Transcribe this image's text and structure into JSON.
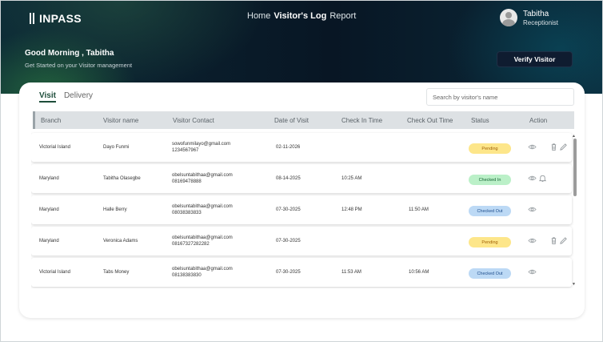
{
  "brand": {
    "logo_text": "INPASS"
  },
  "nav": {
    "items": [
      "Home",
      "Visitor's Log",
      "Report"
    ],
    "active": "Visitor's Log"
  },
  "user": {
    "name": "Tabitha",
    "role": "Receptionist"
  },
  "hero": {
    "greeting": "Good Morning , Tabitha",
    "subtitle": "Get Started on your Visitor management",
    "verify_button": "Verify Visitor"
  },
  "tabs": {
    "visit": "Visit",
    "delivery": "Delivery",
    "active": "Visit"
  },
  "search": {
    "placeholder": "Search by visitor's name",
    "value": ""
  },
  "table": {
    "headers": {
      "branch": "Branch",
      "visitor_name": "Visitor name",
      "visitor_contact": "Visitor Contact",
      "date_of_visit": "Date of Visit",
      "check_in": "Check In Time",
      "check_out": "Check Out Time",
      "status": "Status",
      "action": "Action"
    },
    "rows": [
      {
        "branch": "Victorial Island",
        "name": "Dayo Funmi",
        "email": "sowofunmilayo@gmail.com",
        "phone": "1234567967",
        "date": "02-11-2026",
        "check_in": "",
        "check_out": "",
        "status": "Pending",
        "actions": [
          "eye-icon",
          "trash-icon",
          "pencil-icon"
        ]
      },
      {
        "branch": "Maryland",
        "name": "Tabitha Olasegbe",
        "email": "obelsuntabithaa@gmail.com",
        "phone": "08169478888",
        "date": "08-14-2025",
        "check_in": "10:25 AM",
        "check_out": "",
        "status": "Checked In",
        "actions": [
          "eye-icon",
          "bell-icon"
        ]
      },
      {
        "branch": "Maryland",
        "name": "Halle Berry",
        "email": "obelsuntabithaa@gmail.com",
        "phone": "08038383833",
        "date": "07-30-2025",
        "check_in": "12:48 PM",
        "check_out": "11:50 AM",
        "status": "Checked Out",
        "actions": [
          "eye-icon"
        ]
      },
      {
        "branch": "Maryland",
        "name": "Veronica Adams",
        "email": "obelsuntabithaa@gmail.com",
        "phone": "08167327282282",
        "date": "07-30-2025",
        "check_in": "",
        "check_out": "",
        "status": "Pending",
        "actions": [
          "eye-icon",
          "trash-icon",
          "pencil-icon"
        ]
      },
      {
        "branch": "Victorial Island",
        "name": "Tabs Money",
        "email": "obelsuntabithaa@gmail.com",
        "phone": "08138383830",
        "date": "07-30-2025",
        "check_in": "11:53 AM",
        "check_out": "10:56 AM",
        "status": "Checked Out",
        "actions": [
          "eye-icon"
        ]
      }
    ]
  },
  "colors": {
    "pending_bg": "#fde68a",
    "checked_in_bg": "#bbf0c8",
    "checked_out_bg": "#bcd9f5",
    "accent": "#1d4d3a",
    "button_bg": "#0f1c30"
  }
}
